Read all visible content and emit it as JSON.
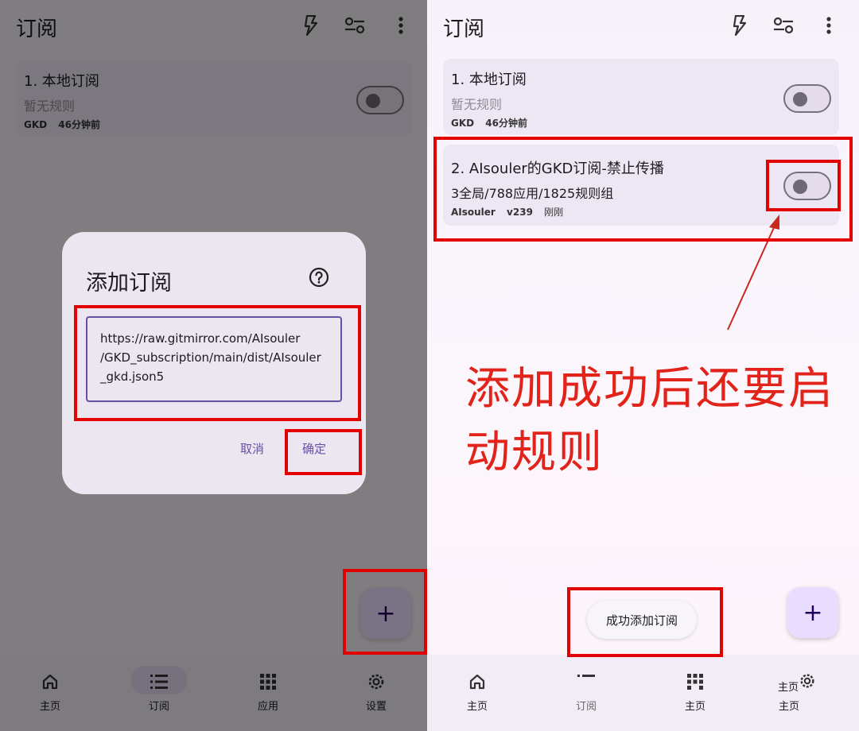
{
  "left": {
    "appbar": {
      "title": "订阅",
      "icons": [
        "flash-icon",
        "tune-icon",
        "more-vert-icon"
      ]
    },
    "subscriptions": [
      {
        "title": "1. 本地订阅",
        "subtitle": "暂无规则",
        "author": "GKD",
        "time": "46分钟前",
        "enabled": false
      }
    ],
    "dialog": {
      "title": "添加订阅",
      "help_icon": "help-icon",
      "url_value": "https://raw.gitmirror.com/AIsouler/GKD_subscription/main/dist/AIsouler_gkd.json5",
      "url_lines": [
        "https://raw.gitmirror.com/AIsouler",
        "/GKD_subscription/main/dist/AIsouler",
        "_gkd.json5"
      ],
      "cancel_label": "取消",
      "confirm_label": "确定"
    },
    "fab_label": "+",
    "nav": [
      {
        "label": "主页",
        "icon": "home-icon"
      },
      {
        "label": "订阅",
        "icon": "list-icon",
        "active": true
      },
      {
        "label": "应用",
        "icon": "apps-icon"
      },
      {
        "label": "设置",
        "icon": "settings-icon"
      }
    ]
  },
  "right": {
    "appbar": {
      "title": "订阅",
      "icons": [
        "flash-icon",
        "tune-icon",
        "more-vert-icon"
      ]
    },
    "subscriptions": [
      {
        "title": "1. 本地订阅",
        "subtitle": "暂无规则",
        "author": "GKD",
        "time": "46分钟前",
        "enabled": false
      },
      {
        "title": "2. AIsouler的GKD订阅-禁止传播",
        "subtitle": "3全局/788应用/1825规则组",
        "author": "AIsouler",
        "version": "v239",
        "time": "刚刚",
        "enabled": false
      }
    ],
    "annotation": "添加成功后还要启动规则",
    "annotation_lines": [
      "添加成功后还要启",
      "动规则"
    ],
    "toast": "成功添加订阅",
    "fab_label": "+",
    "nav": [
      {
        "label": "主页",
        "icon": "home-icon"
      },
      {
        "label": "订阅",
        "icon": "list-icon"
      },
      {
        "label": "主页",
        "icon": "apps-icon"
      },
      {
        "label": "主页",
        "icon": "settings-icon"
      }
    ],
    "nav_overlap_label": "主页"
  },
  "colors": {
    "highlight": "#e30000",
    "accent": "#6650a4",
    "annotation": "#e2231a"
  }
}
